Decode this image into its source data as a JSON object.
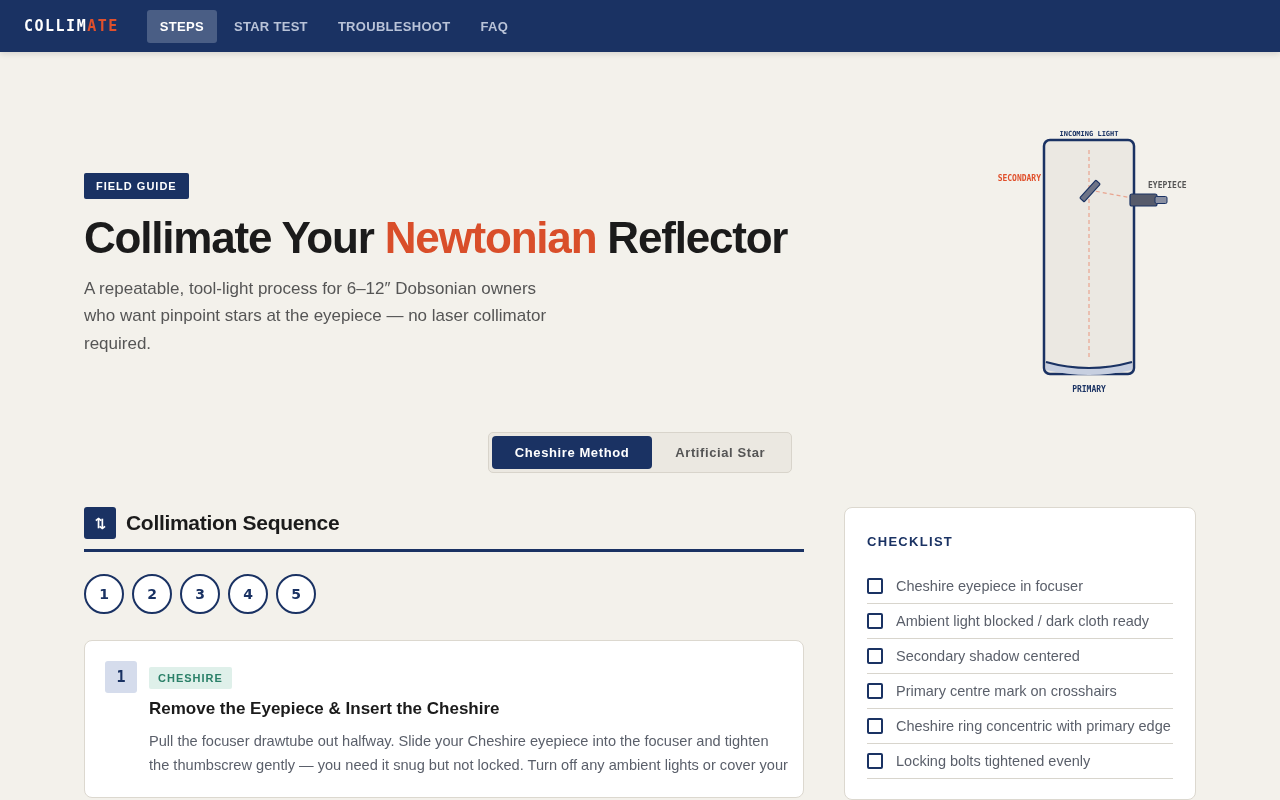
{
  "nav": {
    "logo_main": "COLLIM",
    "logo_accent": "ATE",
    "items": [
      {
        "label": "STEPS",
        "selected": true
      },
      {
        "label": "STAR TEST",
        "selected": false
      },
      {
        "label": "TROUBLESHOOT",
        "selected": false
      },
      {
        "label": "FAQ",
        "selected": false
      }
    ]
  },
  "hero": {
    "badge": "FIELD GUIDE",
    "title_before": "Collimate Your ",
    "title_accent": "Newtonian",
    "title_after": " Reflector",
    "subtitle": "A repeatable, tool-light process for 6–12″ Dobsonian owners who want pinpoint stars at the eyepiece — no laser collimator required.",
    "diagram": {
      "top_label": "INCOMING LIGHT",
      "secondary_label": "SECONDARY",
      "eyepiece_label": "EYEPIECE",
      "primary_label": "PRIMARY"
    }
  },
  "methods": [
    {
      "label": "Cheshire Method",
      "selected": true
    },
    {
      "label": "Artificial Star",
      "selected": false
    }
  ],
  "sequence": {
    "icon": "⇅",
    "title": "Collimation Sequence",
    "steps": [
      "1",
      "2",
      "3",
      "4",
      "5"
    ],
    "card": {
      "number": "1",
      "tag": "CHESHIRE",
      "title": "Remove the Eyepiece & Insert the Cheshire",
      "body": "Pull the focuser drawtube out halfway. Slide your Cheshire eyepiece into the focuser and tighten the thumbscrew gently — you need it snug but not locked. Turn off any ambient lights or cover your"
    }
  },
  "checklist": {
    "title": "CHECKLIST",
    "items": [
      {
        "label": "Cheshire eyepiece in focuser",
        "checked": false
      },
      {
        "label": "Ambient light blocked / dark cloth ready",
        "checked": false
      },
      {
        "label": "Secondary shadow centered",
        "checked": false
      },
      {
        "label": "Primary centre mark on crosshairs",
        "checked": false
      },
      {
        "label": "Cheshire ring concentric with primary edge",
        "checked": false
      },
      {
        "label": "Locking bolts tightened evenly",
        "checked": false
      }
    ]
  }
}
